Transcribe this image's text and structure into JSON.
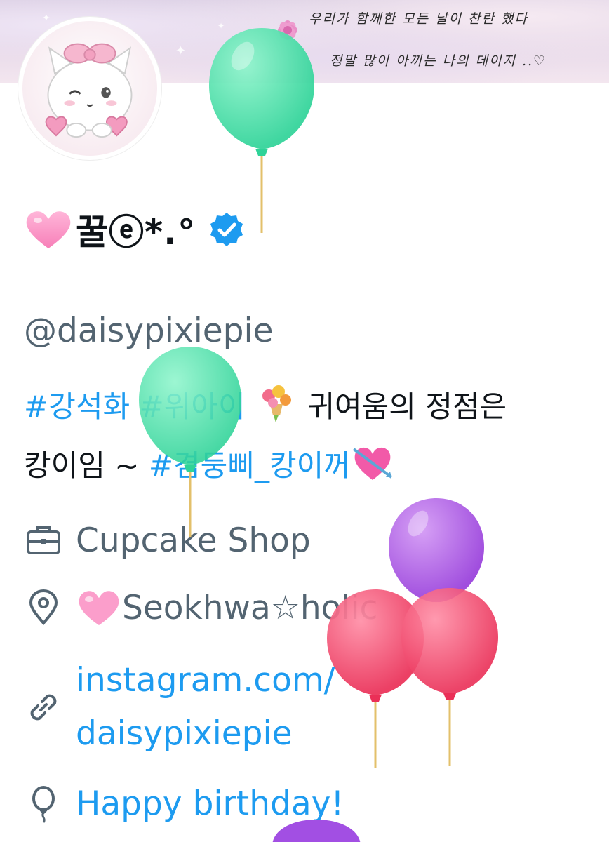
{
  "banner": {
    "line1": "우리가 함께한 모든 날이 찬란 했다",
    "line2": "정말 많이 아끼는 나의 데이지 ..♡"
  },
  "profile": {
    "display_name": "꿀ⓔ*.°",
    "verified": true,
    "handle": "@daisypixiepie",
    "bio_tag1": "#강석화",
    "bio_tag2": "#위아이",
    "bio_text1": "귀여움의 정점은",
    "bio_text2": "캉이임 ~",
    "bio_tag3": "#겸둥삐_캉이꺼"
  },
  "info": {
    "work_icon": "briefcase-icon",
    "work": "Cupcake Shop",
    "location_icon": "location-pin-icon",
    "location": "Seokhwa☆holic",
    "link_icon": "link-icon",
    "link_line1": "instagram.com/",
    "link_line2": "daisypixiepie",
    "birthday_icon": "balloon-icon",
    "birthday": "Happy birthday!"
  },
  "colors": {
    "link_blue": "#1d9bf0",
    "muted_gray": "#536471",
    "text_black": "#0f1419",
    "verified_blue": "#1d9bf0",
    "balloon_green": "#3ee0a6",
    "balloon_purple": "#a24fe3",
    "balloon_red": "#ef3f63"
  }
}
